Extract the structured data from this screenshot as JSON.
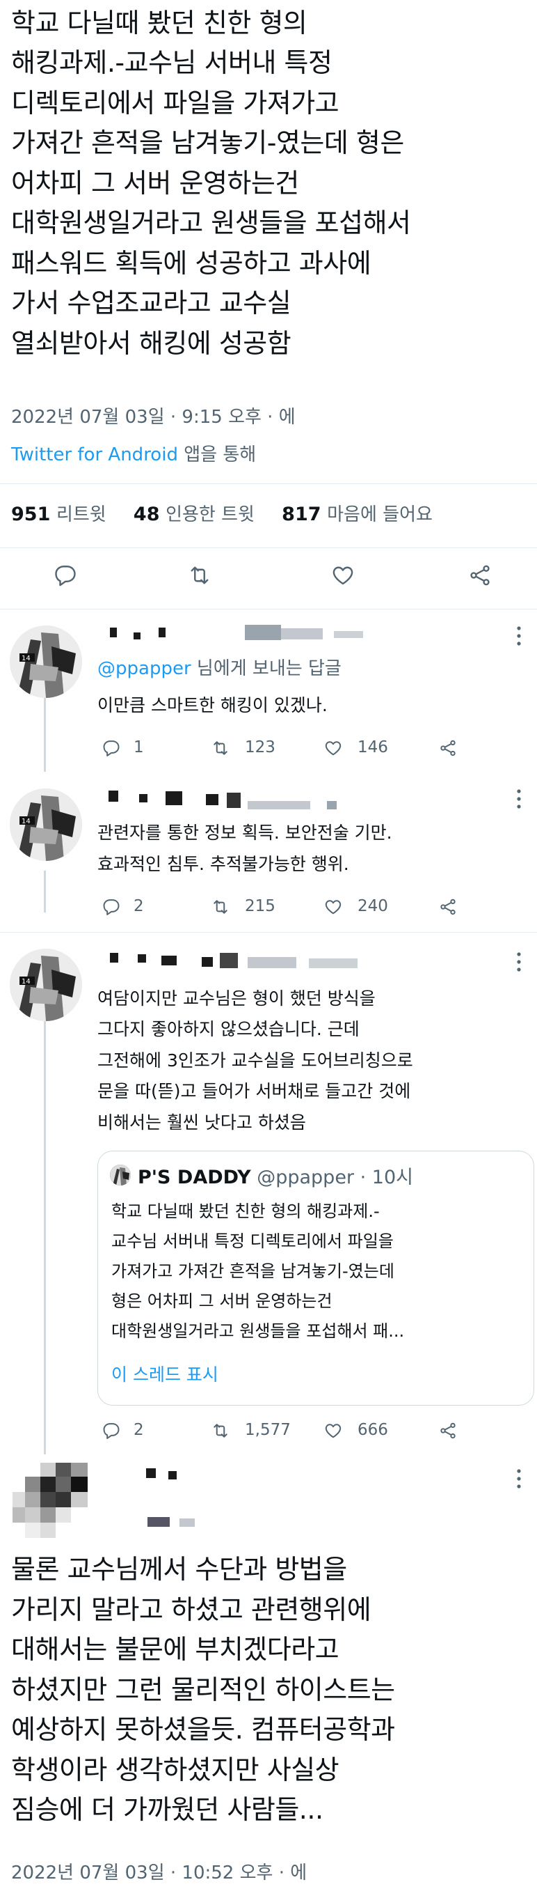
{
  "main_tweet": {
    "lines": [
      "학교 다닐때 봤던 친한 형의",
      "해킹과제.-교수님 서버내 특정",
      "디렉토리에서 파일을 가져가고",
      "가져간 흔적을 남겨놓기-였는데 형은",
      "어차피 그 서버 운영하는건",
      "대학원생일거라고 원생들을 포섭해서",
      "패스워드 획득에 성공하고 과사에",
      "가서 수업조교라고 교수실",
      "열쇠받아서 해킹에 성공함"
    ],
    "timestamp": "2022년 07월 03일 · 9:15 오후 · 에",
    "source": "Twitter for Android",
    "source_suffix": " 앱을 통해",
    "stats": {
      "retweets_count": "951",
      "retweets_label": "리트윗",
      "quotes_count": "48",
      "quotes_label": "인용한 트윗",
      "likes_count": "817",
      "likes_label": "마음에 들어요"
    }
  },
  "replies": [
    {
      "reply_to_handle": "@ppapper",
      "reply_to_suffix": " 님에게 보내는 답글",
      "lines": [
        "이만큼 스마트한 해킹이 있겠나."
      ],
      "replies": "1",
      "retweets": "123",
      "likes": "146"
    },
    {
      "lines": [
        "관련자를 통한 정보 획득. 보안전술 기만.",
        "효과적인 침투. 추적불가능한 행위."
      ],
      "replies": "2",
      "retweets": "215",
      "likes": "240"
    },
    {
      "lines": [
        "여담이지만 교수님은 형이 했던 방식을",
        "그다지 좋아하지 않으셨습니다. 근데",
        "그전해에 3인조가 교수실을 도어브리칭으로",
        "문을 따(뜯)고 들어가 서버채로 들고간 것에",
        "비해서는 훨씬 낫다고 하셨음"
      ],
      "quote": {
        "name": "P'S DADDY",
        "handle": "@ppapper",
        "time": "· 10시",
        "lines": [
          "학교 다닐때 봤던 친한 형의 해킹과제.-",
          "교수님 서버내 특정 디렉토리에서 파일을",
          "가져가고 가져간 흔적을 남겨놓기-였는데",
          "형은 어차피 그 서버 운영하는건",
          "대학원생일거라고 원생들을 포섭해서 패..."
        ],
        "show_thread": "이 스레드 표시"
      },
      "replies": "2",
      "retweets": "1,577",
      "likes": "666"
    }
  ],
  "bottom_tweet": {
    "lines": [
      "물론 교수님께서 수단과 방법을",
      "가리지 말라고 하셨고 관련행위에",
      "대해서는 불문에 부치겠다라고",
      "하셨지만 그런 물리적인 하이스트는",
      "예상하지 못하셨을듯. 컴퓨터공학과",
      "학생이라 생각하셨지만 사실상",
      "짐승에 더 가까웠던 사람들..."
    ],
    "timestamp": "2022년 07월 03일 · 10:52 오후 · 에"
  },
  "icons": {
    "reply": "reply-icon",
    "retweet": "retweet-icon",
    "like": "heart-icon",
    "share": "share-icon",
    "more": "more-icon"
  },
  "colors": {
    "link": "#1d9bf0",
    "muted": "#536471",
    "divider": "#e6ecf0"
  }
}
